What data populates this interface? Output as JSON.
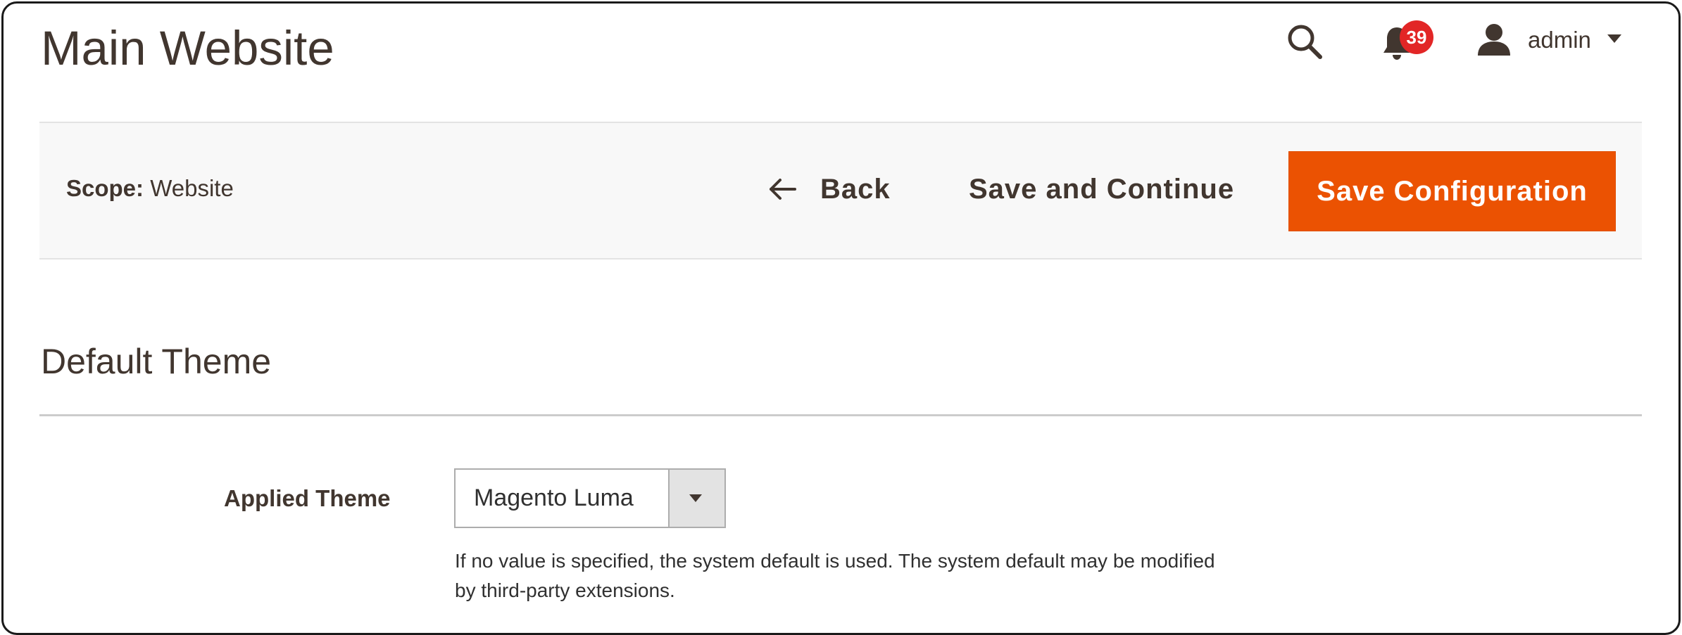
{
  "header": {
    "title": "Main Website",
    "search_icon": "search-icon",
    "notifications": {
      "icon": "bell-icon",
      "count": "39",
      "badge_color": "#e22626"
    },
    "user": {
      "icon": "user-icon",
      "name": "admin"
    }
  },
  "toolbar": {
    "scope_label": "Scope:",
    "scope_value": "Website",
    "back_label": "Back",
    "save_continue_label": "Save and Continue",
    "save_config_label": "Save Configuration",
    "accent_color": "#eb5202"
  },
  "section": {
    "title": "Default Theme",
    "field": {
      "label": "Applied Theme",
      "selected_value": "Magento Luma",
      "note": "If no value is specified, the system default is used. The system default may be modified by third-party extensions."
    }
  }
}
